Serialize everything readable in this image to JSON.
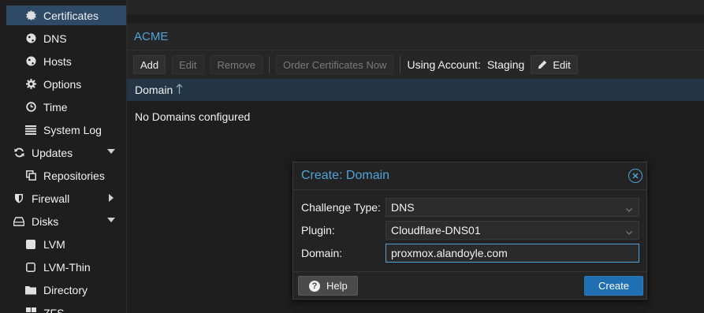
{
  "sidebar": {
    "items": [
      {
        "label": "Certificates",
        "icon": "certificate-icon",
        "selected": true
      },
      {
        "label": "DNS",
        "icon": "globe-icon"
      },
      {
        "label": "Hosts",
        "icon": "globe-icon"
      },
      {
        "label": "Options",
        "icon": "gear-icon"
      },
      {
        "label": "Time",
        "icon": "clock-icon"
      },
      {
        "label": "System Log",
        "icon": "list-icon"
      },
      {
        "label": "Updates",
        "icon": "refresh-icon",
        "expanded": true
      },
      {
        "label": "Repositories",
        "icon": "copy-icon"
      },
      {
        "label": "Firewall",
        "icon": "shield-icon",
        "expanded": false
      },
      {
        "label": "Disks",
        "icon": "hdd-icon",
        "expanded": true
      },
      {
        "label": "LVM",
        "icon": "square-icon"
      },
      {
        "label": "LVM-Thin",
        "icon": "square-outline-icon"
      },
      {
        "label": "Directory",
        "icon": "folder-icon"
      },
      {
        "label": "ZFS",
        "icon": "grid-icon"
      }
    ]
  },
  "panel": {
    "title": "ACME",
    "toolbar": {
      "add": "Add",
      "edit": "Edit",
      "remove": "Remove",
      "order": "Order Certificates Now",
      "account_label": "Using Account:",
      "account_value": "Staging",
      "account_edit": "Edit"
    },
    "grid": {
      "column": "Domain",
      "empty": "No Domains configured"
    }
  },
  "dialog": {
    "title": "Create: Domain",
    "fields": {
      "challenge_label": "Challenge Type:",
      "challenge_value": "DNS",
      "plugin_label": "Plugin:",
      "plugin_value": "Cloudflare-DNS01",
      "domain_label": "Domain:",
      "domain_value": "proxmox.alandoyle.com"
    },
    "help": "Help",
    "create": "Create"
  },
  "colors": {
    "accent": "#4fa3d8",
    "selected_bg": "#2e4a66",
    "primary_button": "#1f6fb2"
  }
}
